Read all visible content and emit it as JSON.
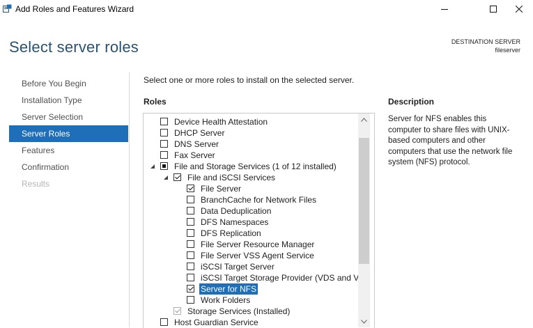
{
  "window": {
    "title": "Add Roles and Features Wizard",
    "minimize_icon": "minimize-icon",
    "maximize_icon": "maximize-icon",
    "close_icon": "close-icon"
  },
  "header": {
    "title": "Select server roles",
    "destination_label": "DESTINATION SERVER",
    "destination_value": "fileserver"
  },
  "nav": {
    "items": [
      {
        "label": "Before You Begin",
        "state": "normal"
      },
      {
        "label": "Installation Type",
        "state": "normal"
      },
      {
        "label": "Server Selection",
        "state": "normal"
      },
      {
        "label": "Server Roles",
        "state": "active"
      },
      {
        "label": "Features",
        "state": "normal"
      },
      {
        "label": "Confirmation",
        "state": "normal"
      },
      {
        "label": "Results",
        "state": "disabled"
      }
    ]
  },
  "main": {
    "instruction": "Select one or more roles to install on the selected server.",
    "roles_heading": "Roles",
    "description_heading": "Description",
    "description_text": "Server for NFS enables this computer to share files with UNIX-based computers and other computers that use the network file system (NFS) protocol."
  },
  "roles": [
    {
      "label": "Device Health Attestation",
      "level": 0,
      "checkbox": "unchecked",
      "expander": "none"
    },
    {
      "label": "DHCP Server",
      "level": 0,
      "checkbox": "unchecked",
      "expander": "none"
    },
    {
      "label": "DNS Server",
      "level": 0,
      "checkbox": "unchecked",
      "expander": "none"
    },
    {
      "label": "Fax Server",
      "level": 0,
      "checkbox": "unchecked",
      "expander": "none"
    },
    {
      "label": "File and Storage Services (1 of 12 installed)",
      "level": 0,
      "checkbox": "partial",
      "expander": "expanded"
    },
    {
      "label": "File and iSCSI Services",
      "level": 1,
      "checkbox": "checked",
      "expander": "expanded"
    },
    {
      "label": "File Server",
      "level": 2,
      "checkbox": "checked",
      "expander": "none"
    },
    {
      "label": "BranchCache for Network Files",
      "level": 2,
      "checkbox": "unchecked",
      "expander": "none"
    },
    {
      "label": "Data Deduplication",
      "level": 2,
      "checkbox": "unchecked",
      "expander": "none"
    },
    {
      "label": "DFS Namespaces",
      "level": 2,
      "checkbox": "unchecked",
      "expander": "none"
    },
    {
      "label": "DFS Replication",
      "level": 2,
      "checkbox": "unchecked",
      "expander": "none"
    },
    {
      "label": "File Server Resource Manager",
      "level": 2,
      "checkbox": "unchecked",
      "expander": "none"
    },
    {
      "label": "File Server VSS Agent Service",
      "level": 2,
      "checkbox": "unchecked",
      "expander": "none"
    },
    {
      "label": "iSCSI Target Server",
      "level": 2,
      "checkbox": "unchecked",
      "expander": "none"
    },
    {
      "label": "iSCSI Target Storage Provider (VDS and VSS",
      "level": 2,
      "checkbox": "unchecked",
      "expander": "none"
    },
    {
      "label": "Server for NFS",
      "level": 2,
      "checkbox": "checked",
      "expander": "none",
      "selected": true
    },
    {
      "label": "Work Folders",
      "level": 2,
      "checkbox": "unchecked",
      "expander": "none"
    },
    {
      "label": "Storage Services (Installed)",
      "level": 1,
      "checkbox": "checked-disabled",
      "expander": "none"
    },
    {
      "label": "Host Guardian Service",
      "level": 0,
      "checkbox": "unchecked",
      "expander": "none"
    }
  ],
  "colors": {
    "accent": "#1e6fb8",
    "title": "#2b5270"
  }
}
